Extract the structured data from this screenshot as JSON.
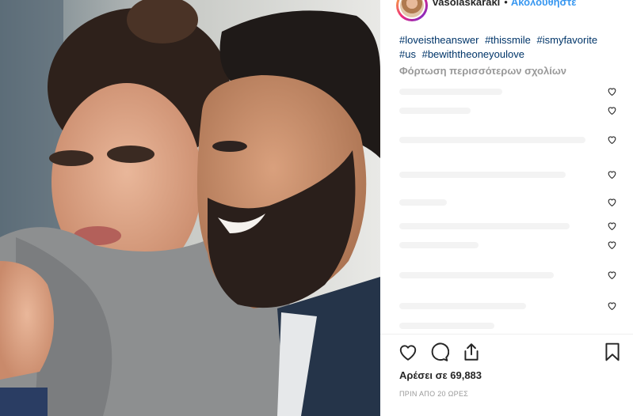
{
  "post": {
    "username": "vasolaskaraki",
    "separator": "•",
    "follow_label": "Ακολουθήστε",
    "hashtags": [
      "#loveistheanswer",
      "#thissmile",
      "#ismyfavorite",
      "#us",
      "#bewiththeoneyoulove"
    ],
    "load_more_comments": "Φόρτωση περισσότερων σχολίων",
    "likes_label": "Αρέσει σε 69,883",
    "timestamp": "ΠΡΙΝ ΑΠΟ 20 ΩΡΕΣ",
    "comment_count_visible": 11
  },
  "icons": {
    "like": "heart-icon",
    "comment": "comment-bubble-icon",
    "share": "share-icon",
    "save": "bookmark-icon"
  },
  "colors": {
    "link": "#3897f0",
    "hashtag": "#003569",
    "muted": "#999999",
    "text": "#262626"
  }
}
